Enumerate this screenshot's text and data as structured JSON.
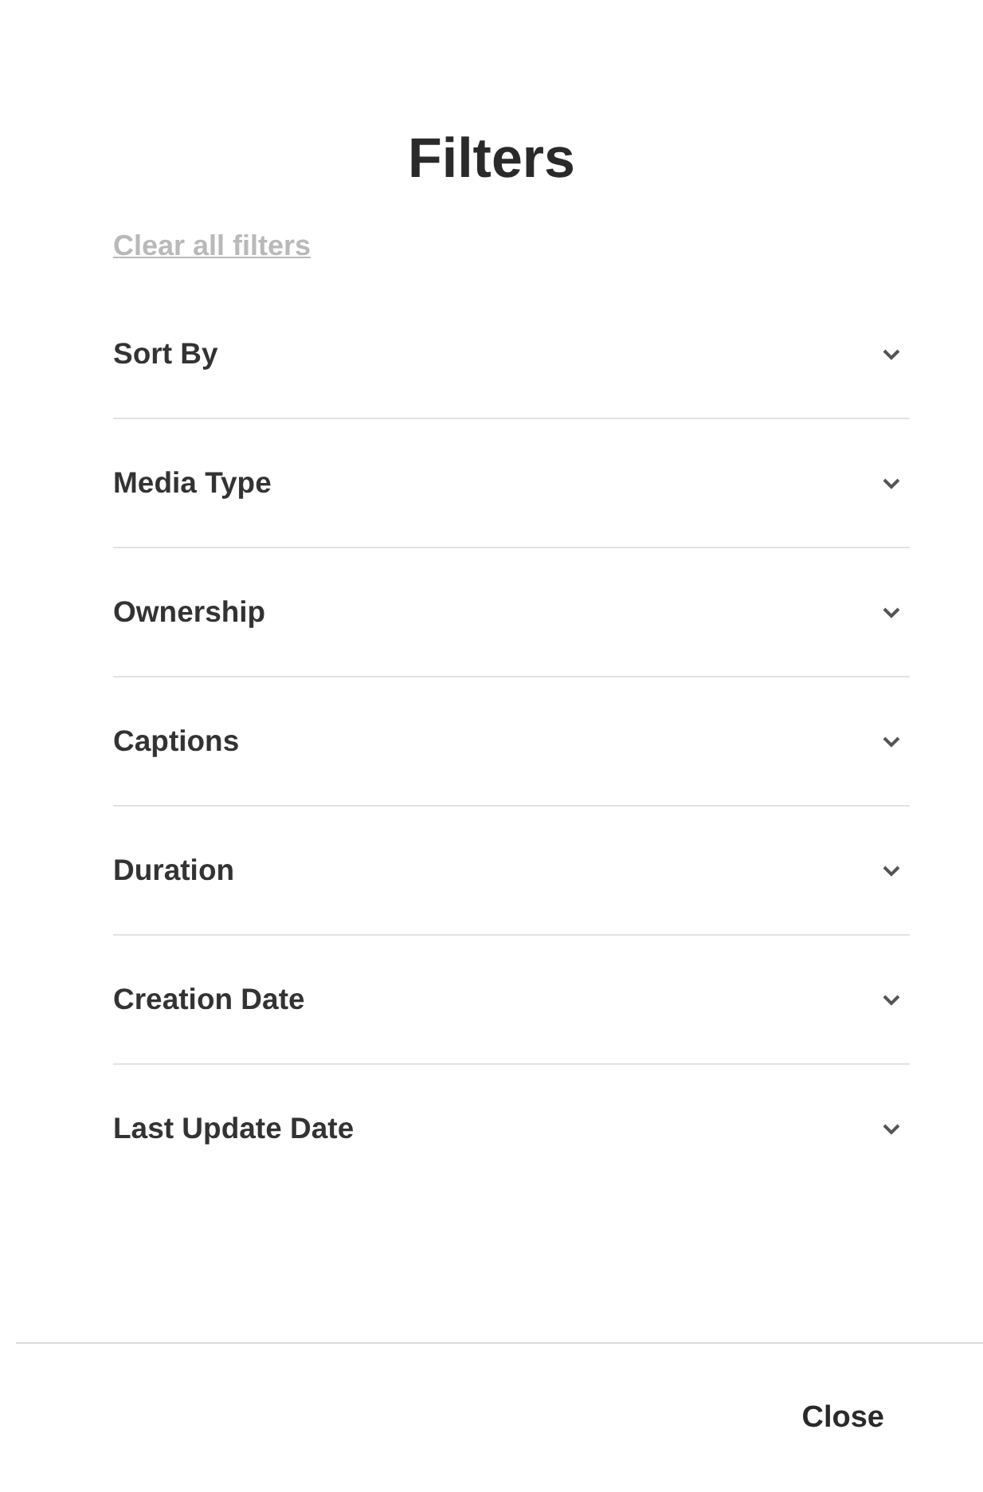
{
  "title": "Filters",
  "clear_link": "Clear all filters",
  "sections": [
    {
      "label": "Sort By",
      "expanded": false
    },
    {
      "label": "Media Type",
      "expanded": false
    },
    {
      "label": "Ownership",
      "expanded": false
    },
    {
      "label": "Captions",
      "expanded": false
    },
    {
      "label": "Duration",
      "expanded": false
    },
    {
      "label": "Creation Date",
      "expanded": false
    },
    {
      "label": "Last Update Date",
      "expanded": false
    }
  ],
  "footer": {
    "close_button": "Close"
  }
}
